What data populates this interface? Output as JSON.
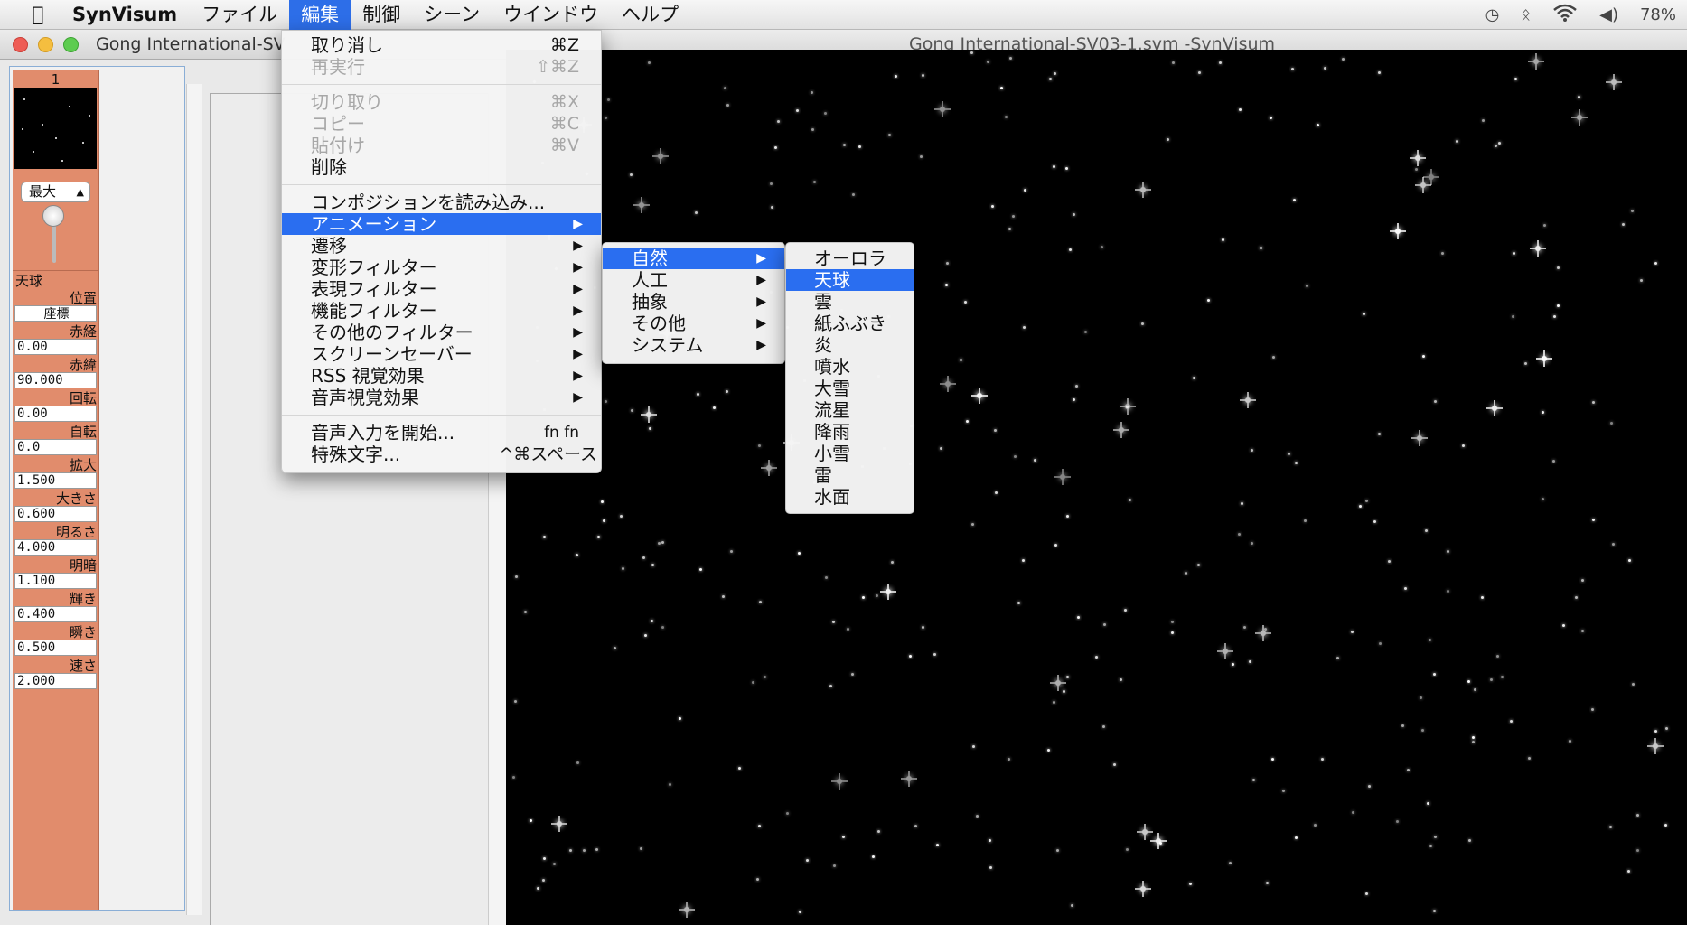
{
  "menubar": {
    "apple_icon": "apple-icon",
    "app_name": "SynVisum",
    "menus": [
      "ファイル",
      "編集",
      "制御",
      "シーン",
      "ウインドウ",
      "ヘルプ"
    ],
    "active_menu": "編集",
    "battery": "78%",
    "status_icons": [
      "time-machine-icon",
      "bluetooth-icon",
      "wifi-icon",
      "volume-icon"
    ]
  },
  "window": {
    "title_partial": "Gong International-SV",
    "title": "Gong International-SV03-1.svm -SynVisum"
  },
  "left_panel": {
    "clip_number": "1",
    "size_select": "最大",
    "category": "天球",
    "params": [
      {
        "label": "位置",
        "value": "座標"
      },
      {
        "label": "赤経",
        "value": "0.00"
      },
      {
        "label": "赤緯",
        "value": "90.000"
      },
      {
        "label": "回転",
        "value": "0.00"
      },
      {
        "label": "自転",
        "value": "0.0"
      },
      {
        "label": "拡大",
        "value": "1.500"
      },
      {
        "label": "大きさ",
        "value": "0.600"
      },
      {
        "label": "明るさ",
        "value": "4.000"
      },
      {
        "label": "明暗",
        "value": "1.100"
      },
      {
        "label": "輝き",
        "value": "0.400"
      },
      {
        "label": "瞬き",
        "value": "0.500"
      },
      {
        "label": "速さ",
        "value": "2.000"
      }
    ]
  },
  "edit_menu": {
    "items": [
      {
        "label": "取り消し",
        "shortcut": "⌘Z",
        "enabled": true
      },
      {
        "label": "再実行",
        "shortcut": "⇧⌘Z",
        "enabled": false
      },
      {
        "label": "切り取り",
        "shortcut": "⌘X",
        "enabled": false
      },
      {
        "label": "コピー",
        "shortcut": "⌘C",
        "enabled": false
      },
      {
        "label": "貼付け",
        "shortcut": "⌘V",
        "enabled": false
      },
      {
        "label": "削除",
        "shortcut": "",
        "enabled": true
      },
      {
        "label": "コンポジションを読み込み...",
        "shortcut": ""
      },
      {
        "label": "アニメーション",
        "submenu": true
      },
      {
        "label": "遷移",
        "submenu": true
      },
      {
        "label": "変形フィルター",
        "submenu": true
      },
      {
        "label": "表現フィルター",
        "submenu": true
      },
      {
        "label": "機能フィルター",
        "submenu": true
      },
      {
        "label": "その他のフィルター",
        "submenu": true
      },
      {
        "label": "スクリーンセーバー",
        "submenu": true
      },
      {
        "label": "RSS 視覚効果",
        "submenu": true
      },
      {
        "label": "音声視覚効果",
        "submenu": true
      },
      {
        "label": "音声入力を開始...",
        "shortcut": "fn fn"
      },
      {
        "label": "特殊文字...",
        "shortcut": "^⌘スペース"
      }
    ],
    "highlighted": "アニメーション"
  },
  "animation_menu": {
    "items": [
      "自然",
      "人工",
      "抽象",
      "その他",
      "システム"
    ],
    "highlighted": "自然"
  },
  "nature_menu": {
    "items": [
      "オーロラ",
      "天球",
      "雲",
      "紙ふぶき",
      "炎",
      "噴水",
      "大雪",
      "流星",
      "降雨",
      "小雪",
      "雷",
      "水面"
    ],
    "highlighted": "天球"
  },
  "colors": {
    "highlight": "#2a6ef0",
    "clip_bg": "#e18c6c",
    "canvas_bg": "#000000"
  }
}
